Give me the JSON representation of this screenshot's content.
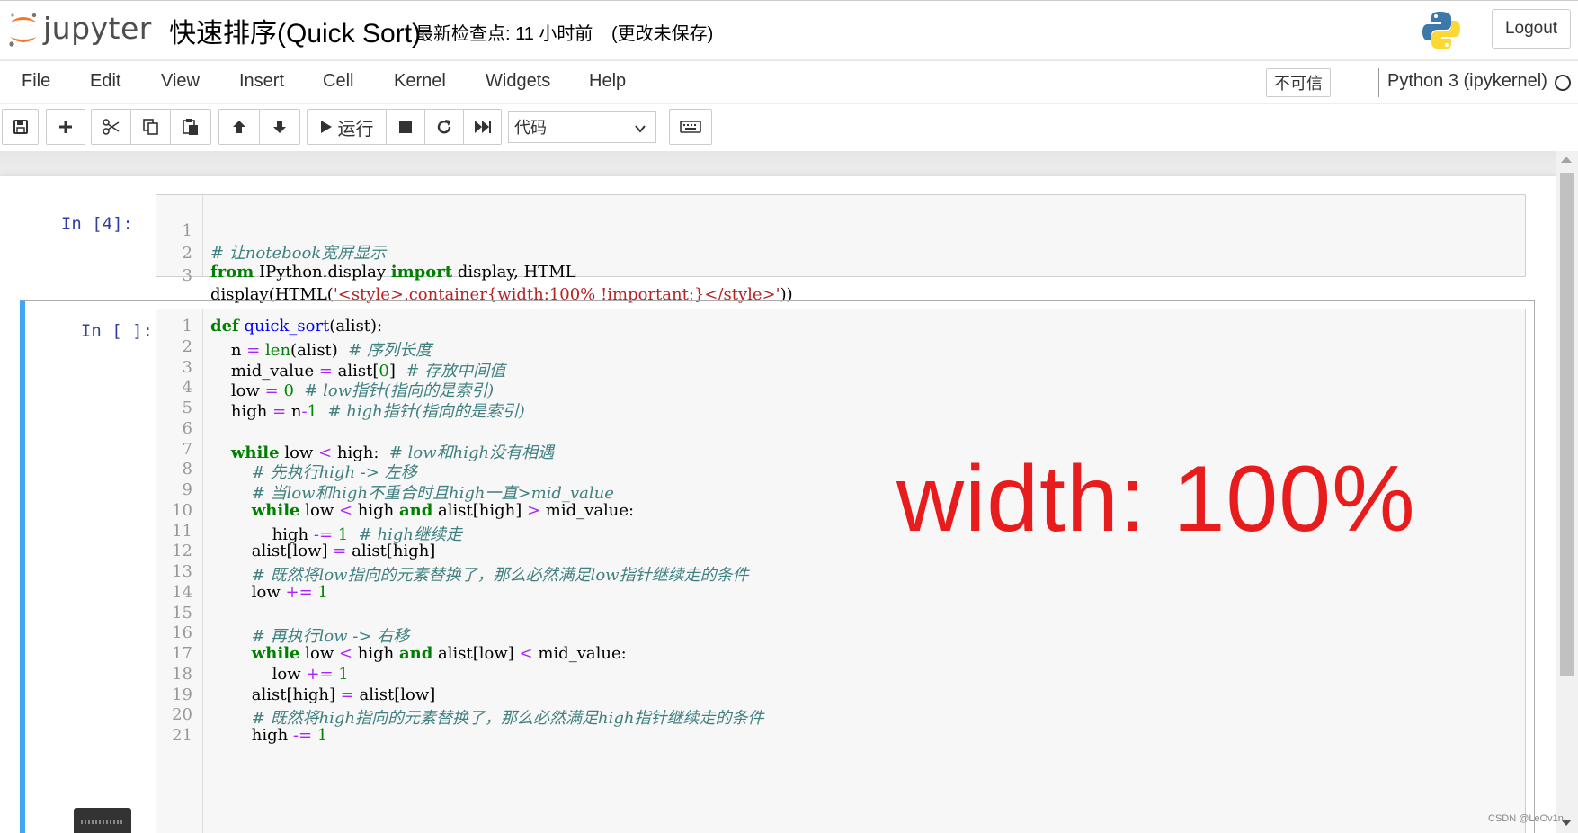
{
  "header": {
    "logo_text": "jupyter",
    "notebook_title": "快速排序(Quick Sort)",
    "checkpoint": "最新检查点: 11 小时前",
    "autosave_status": "(更改未保存)",
    "logout_label": "Logout"
  },
  "menubar": {
    "items": [
      "File",
      "Edit",
      "View",
      "Insert",
      "Cell",
      "Kernel",
      "Widgets",
      "Help"
    ],
    "trust_label": "不可信",
    "kernel_name": "Python 3 (ipykernel)"
  },
  "toolbar": {
    "run_label": "运行",
    "cell_type": "代码",
    "icons": [
      "save-icon",
      "plus-icon",
      "scissors-icon",
      "copy-icon",
      "paste-icon",
      "arrow-up-icon",
      "arrow-down-icon",
      "play-icon",
      "stop-icon",
      "restart-icon",
      "fast-forward-icon",
      "chevron-down-icon",
      "keyboard-icon"
    ]
  },
  "cells": [
    {
      "prompt": "In  [4]:",
      "lines": [
        "# 让notebook宽屏显示",
        "from IPython.display import display, HTML",
        "display(HTML('<style>.container{width:100% !important;}</style>'))"
      ]
    },
    {
      "prompt": "In  [ ]:",
      "lines": [
        "def quick_sort(alist):",
        "    n = len(alist)  # 序列长度",
        "    mid_value = alist[0]  # 存放中间值",
        "    low = 0  # low指针(指向的是索引)",
        "    high = n-1  # high指针(指向的是索引)",
        "",
        "    while low < high:  # low和high没有相遇",
        "        # 先执行high -> 左移",
        "        # 当low和high不重合时且high一直>mid_value",
        "        while low < high and alist[high] > mid_value:",
        "            high -= 1  # high继续走",
        "        alist[low] = alist[high]",
        "        # 既然将low指向的元素替换了，那么必然满足low指针继续走的条件",
        "        low += 1",
        "",
        "        # 再执行low -> 右移",
        "        while low < high and alist[low] < mid_value:",
        "            low += 1",
        "        alist[high] = alist[low]",
        "        # 既然将high指向的元素替换了，那么必然满足high指针继续走的条件",
        "        high -= 1"
      ]
    }
  ],
  "annotation": "width: 100%",
  "watermark": "CSDN @LeOv1n",
  "colors": {
    "keyword": "#008000",
    "function": "#0000ff",
    "comment": "#408080",
    "operator": "#aa22ff",
    "string": "#ba2121",
    "prompt": "#303f9f",
    "selected_border": "#42a5f5",
    "annotation": "#e81c1c"
  }
}
